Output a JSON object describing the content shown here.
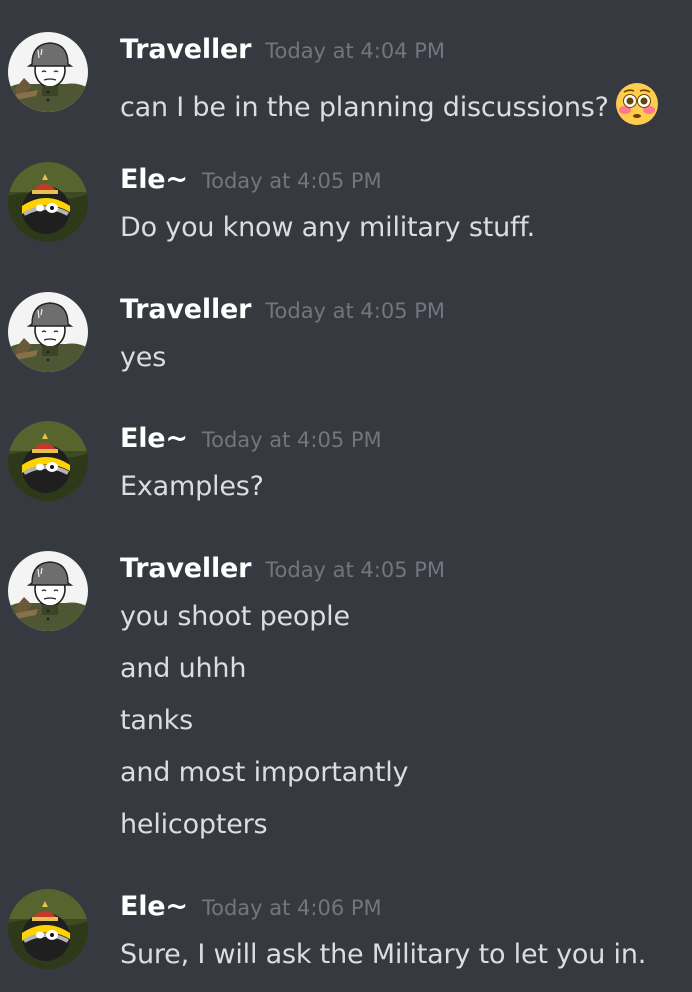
{
  "messages": [
    {
      "author": "Traveller",
      "time": "Today at 4:04 PM",
      "avatar": "soldier-avatar",
      "lines": [
        "can I be in the planning discussions?"
      ],
      "emoji": "flushed-face-emoji"
    },
    {
      "author": "Ele~",
      "time": "Today at 4:05 PM",
      "avatar": "countryball-avatar",
      "lines": [
        "Do you know any military stuff."
      ]
    },
    {
      "author": "Traveller",
      "time": "Today at 4:05 PM",
      "avatar": "soldier-avatar",
      "lines": [
        "yes"
      ]
    },
    {
      "author": "Ele~",
      "time": "Today at 4:05 PM",
      "avatar": "countryball-avatar",
      "lines": [
        "Examples?"
      ]
    },
    {
      "author": "Traveller",
      "time": "Today at 4:05 PM",
      "avatar": "soldier-avatar",
      "lines": [
        "you shoot people",
        "and uhhh",
        "tanks",
        "and most importantly",
        "helicopters"
      ]
    },
    {
      "author": "Ele~",
      "time": "Today at 4:06 PM",
      "avatar": "countryball-avatar",
      "lines": [
        "Sure, I will ask the Military to let you in."
      ]
    }
  ],
  "colors": {
    "background": "#36393f",
    "username": "#ffffff",
    "timestamp": "#72767d",
    "text": "#dcddde"
  }
}
